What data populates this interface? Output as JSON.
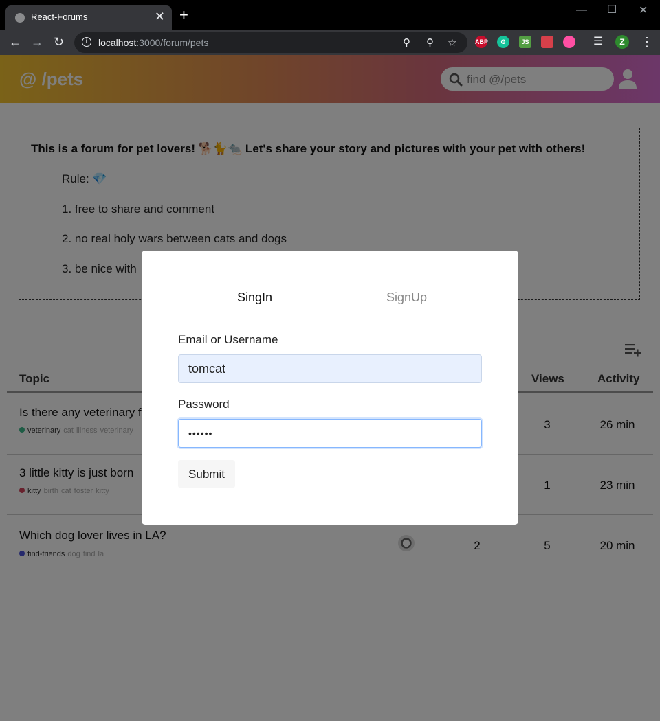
{
  "browser": {
    "tab_title": "React-Forums",
    "close_glyph": "✕",
    "new_tab_glyph": "+",
    "url_host": "localhost",
    "url_path": ":3000/forum/pets",
    "extensions": [
      {
        "name": "adblock-plus-icon",
        "label": "ABP",
        "color": "#c70d2c"
      },
      {
        "name": "grammarly-icon",
        "label": "G",
        "color": "#15c39a"
      },
      {
        "name": "nodejs-icon",
        "label": "JS",
        "color": "#539e43"
      },
      {
        "name": "extension-red-icon",
        "label": "",
        "color": "#d6404a"
      },
      {
        "name": "dark-mode-icon",
        "label": "",
        "color": "#ff4fa3"
      }
    ],
    "profile_initial": "Z"
  },
  "header": {
    "brand": "@ /pets",
    "search_placeholder": "find @/pets"
  },
  "info": {
    "title": "This is a forum for pet lovers! 🐕🐈🐀 Let's share your story and pictures with your pet with others!",
    "rules": [
      "Rule: 💎",
      "1. free to share and comment",
      "2. no real holy wars between cats and dogs",
      "3. be nice with"
    ]
  },
  "table": {
    "headers": {
      "topic": "Topic",
      "views": "Views",
      "activity": "Activity"
    },
    "rows": [
      {
        "title": "Is there any veterinary f",
        "category": "veterinary",
        "dot": "#3cb98a",
        "tags": [
          "cat",
          "illness",
          "veterinary"
        ],
        "replies": "",
        "views": "3",
        "activity": "26 min"
      },
      {
        "title": "3 little kitty is just born",
        "category": "kitty",
        "dot": "#d0435b",
        "tags": [
          "birth",
          "cat",
          "foster",
          "kitty"
        ],
        "replies": "",
        "views": "1",
        "activity": "23 min"
      },
      {
        "title": "Which dog lover lives in LA?",
        "category": "find-friends",
        "dot": "#4a53d8",
        "tags": [
          "dog",
          "find",
          "la"
        ],
        "replies": "2",
        "views": "5",
        "activity": "20 min"
      }
    ]
  },
  "modal": {
    "tab_signin": "SingIn",
    "tab_signup": "SignUp",
    "email_label": "Email or Username",
    "email_value": "tomcat",
    "password_label": "Password",
    "password_value": "••••••",
    "submit": "Submit"
  }
}
